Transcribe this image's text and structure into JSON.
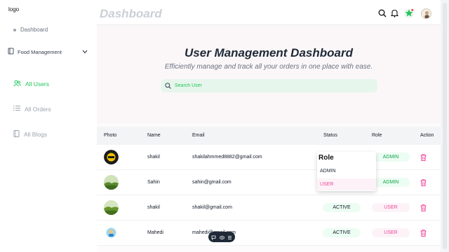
{
  "sidebar": {
    "logo": "logo",
    "dashboard_label": "Dashboard",
    "food_label": "Food Management",
    "items": [
      {
        "label": "All Users",
        "active": true
      },
      {
        "label": "All Orders",
        "active": false
      },
      {
        "label": "All Blogs",
        "active": false
      }
    ]
  },
  "header": {
    "title": "Dashboard",
    "icons": [
      "search-icon",
      "bell-icon",
      "star-badge-icon",
      "avatar"
    ]
  },
  "hero": {
    "title": "User Management Dashboard",
    "subtitle": "Efficiently manage and track all your orders in one place with ease.",
    "search_placeholder": "Search User"
  },
  "table": {
    "headers": [
      "Photo",
      "Name",
      "Email",
      "Status",
      "Role",
      "Action"
    ],
    "rows": [
      {
        "name": "shakil",
        "email": "shakilahmmed8882@gmail.com",
        "status": "",
        "role": "ADMIN"
      },
      {
        "name": "Sahin",
        "email": "sahin@gmail.com",
        "status": "",
        "role": "ADMIN"
      },
      {
        "name": "shakil",
        "email": "shakil@gmail.com",
        "status": "ACTIVE",
        "role": "USER"
      },
      {
        "name": "Mahedi",
        "email": "mahedi@gmail.com",
        "status": "ACTIVE",
        "role": "USER"
      }
    ]
  },
  "role_dropdown": {
    "title": "Role",
    "options": [
      "ADMIN",
      "USER"
    ],
    "selected": "USER"
  },
  "colors": {
    "accent_green": "#22c55e",
    "accent_pink": "#ec4899",
    "title_gray": "#cbd0d6"
  }
}
